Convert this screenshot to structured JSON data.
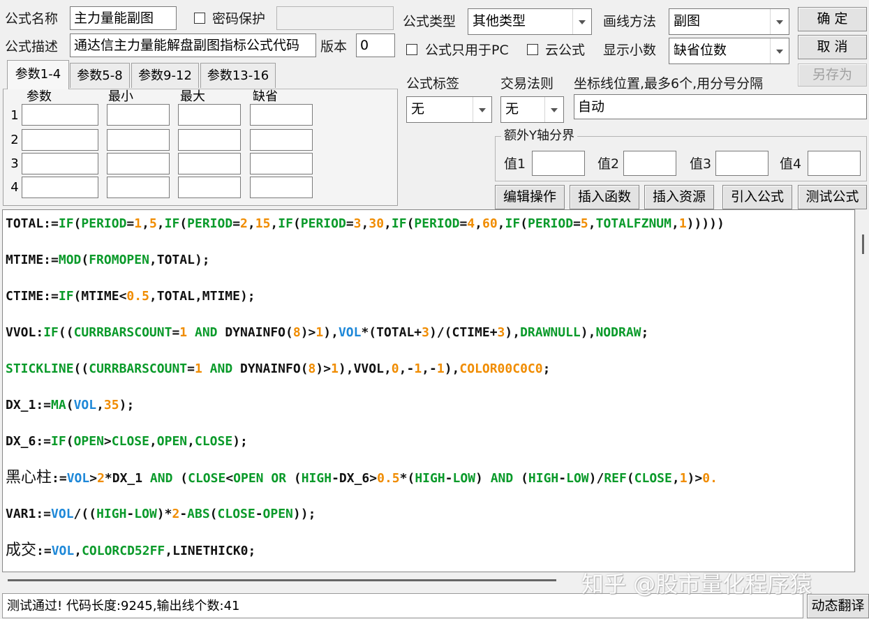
{
  "form": {
    "name_label": "公式名称",
    "name_value": "主力量能副图",
    "password_label": "密码保护",
    "desc_label": "公式描述",
    "desc_value": "通达信主力量能解盘副图指标公式代码",
    "version_label": "版本",
    "version_value": "0",
    "type_label": "公式类型",
    "type_value": "其他类型",
    "draw_label": "画线方法",
    "draw_value": "副图",
    "pc_only_label": "公式只用于PC",
    "cloud_label": "云公式",
    "decimals_label": "显示小数",
    "decimals_value": "缺省位数",
    "tag_label": "公式标签",
    "tag_value": "无",
    "rule_label": "交易法则",
    "rule_value": "无",
    "coord_label": "坐标线位置,最多6个,用分号分隔",
    "coord_value": "自动",
    "yaxis_group": "额外Y轴分界",
    "y1_label": "值1",
    "y2_label": "值2",
    "y3_label": "值3",
    "y4_label": "值4"
  },
  "buttons": {
    "ok": "确 定",
    "cancel": "取 消",
    "save_as": "另存为",
    "edit_ops": "编辑操作",
    "insert_func": "插入函数",
    "insert_res": "插入资源",
    "import": "引入公式",
    "test": "测试公式",
    "translate": "动态翻译"
  },
  "tabs": [
    "参数1-4",
    "参数5-8",
    "参数9-12",
    "参数13-16"
  ],
  "params": {
    "headers": [
      "参数",
      "最小",
      "最大",
      "缺省"
    ],
    "rows": [
      "1",
      "2",
      "3",
      "4"
    ]
  },
  "code_lines": [
    [
      [
        "TOTAL:=",
        "k"
      ],
      [
        "IF",
        "g"
      ],
      [
        "(",
        "k"
      ],
      [
        "PERIOD",
        "g"
      ],
      [
        "=",
        "k"
      ],
      [
        "1",
        "o"
      ],
      [
        ",",
        "k"
      ],
      [
        "5",
        "o"
      ],
      [
        ",",
        "k"
      ],
      [
        "IF",
        "g"
      ],
      [
        "(",
        "k"
      ],
      [
        "PERIOD",
        "g"
      ],
      [
        "=",
        "k"
      ],
      [
        "2",
        "o"
      ],
      [
        ",",
        "k"
      ],
      [
        "15",
        "o"
      ],
      [
        ",",
        "k"
      ],
      [
        "IF",
        "g"
      ],
      [
        "(",
        "k"
      ],
      [
        "PERIOD",
        "g"
      ],
      [
        "=",
        "k"
      ],
      [
        "3",
        "o"
      ],
      [
        ",",
        "k"
      ],
      [
        "30",
        "o"
      ],
      [
        ",",
        "k"
      ],
      [
        "IF",
        "g"
      ],
      [
        "(",
        "k"
      ],
      [
        "PERIOD",
        "g"
      ],
      [
        "=",
        "k"
      ],
      [
        "4",
        "o"
      ],
      [
        ",",
        "k"
      ],
      [
        "60",
        "o"
      ],
      [
        ",",
        "k"
      ],
      [
        "IF",
        "g"
      ],
      [
        "(",
        "k"
      ],
      [
        "PERIOD",
        "g"
      ],
      [
        "=",
        "k"
      ],
      [
        "5",
        "o"
      ],
      [
        ",",
        "k"
      ],
      [
        "TOTALFZNUM",
        "g"
      ],
      [
        ",",
        "k"
      ],
      [
        "1",
        "o"
      ],
      [
        ")))))",
        "k"
      ]
    ],
    [
      [
        "MTIME:=",
        "k"
      ],
      [
        "MOD",
        "g"
      ],
      [
        "(",
        "k"
      ],
      [
        "FROMOPEN",
        "g"
      ],
      [
        ",TOTAL);",
        "k"
      ]
    ],
    [
      [
        "CTIME:=",
        "k"
      ],
      [
        "IF",
        "g"
      ],
      [
        "(MTIME<",
        "k"
      ],
      [
        "0.5",
        "o"
      ],
      [
        ",TOTAL,MTIME);",
        "k"
      ]
    ],
    [
      [
        "VVOL:",
        "k"
      ],
      [
        "IF",
        "g"
      ],
      [
        "((",
        "k"
      ],
      [
        "CURRBARSCOUNT",
        "g"
      ],
      [
        "=",
        "k"
      ],
      [
        "1",
        "o"
      ],
      [
        " AND ",
        "g"
      ],
      [
        "DYNAINFO(",
        "k"
      ],
      [
        "8",
        "o"
      ],
      [
        ")>",
        "k"
      ],
      [
        "1",
        "o"
      ],
      [
        "),",
        "k"
      ],
      [
        "VOL",
        "b"
      ],
      [
        "*(TOTAL+",
        "k"
      ],
      [
        "3",
        "o"
      ],
      [
        ")/(CTIME+",
        "k"
      ],
      [
        "3",
        "o"
      ],
      [
        "),",
        "k"
      ],
      [
        "DRAWNULL",
        "g"
      ],
      [
        "),",
        "k"
      ],
      [
        "NODRAW",
        "g"
      ],
      [
        ";",
        "k"
      ]
    ],
    [
      [
        "STICKLINE",
        "g"
      ],
      [
        "((",
        "k"
      ],
      [
        "CURRBARSCOUNT",
        "g"
      ],
      [
        "=",
        "k"
      ],
      [
        "1",
        "o"
      ],
      [
        " AND ",
        "g"
      ],
      [
        "DYNAINFO(",
        "k"
      ],
      [
        "8",
        "o"
      ],
      [
        ")>",
        "k"
      ],
      [
        "1",
        "o"
      ],
      [
        "),VVOL,",
        "k"
      ],
      [
        "0",
        "o"
      ],
      [
        ",-",
        "k"
      ],
      [
        "1",
        "o"
      ],
      [
        ",-",
        "k"
      ],
      [
        "1",
        "o"
      ],
      [
        "),",
        "k"
      ],
      [
        "COLOR00C0C0",
        "o"
      ],
      [
        ";",
        "k"
      ]
    ],
    [
      [
        "DX_1:=",
        "k"
      ],
      [
        "MA",
        "g"
      ],
      [
        "(",
        "k"
      ],
      [
        "VOL",
        "b"
      ],
      [
        ",",
        "k"
      ],
      [
        "35",
        "o"
      ],
      [
        ");",
        "k"
      ]
    ],
    [
      [
        "DX_6:=",
        "k"
      ],
      [
        "IF",
        "g"
      ],
      [
        "(",
        "k"
      ],
      [
        "OPEN",
        "g"
      ],
      [
        ">",
        "k"
      ],
      [
        "CLOSE",
        "g"
      ],
      [
        ",",
        "k"
      ],
      [
        "OPEN",
        "g"
      ],
      [
        ",",
        "k"
      ],
      [
        "CLOSE",
        "g"
      ],
      [
        ");",
        "k"
      ]
    ],
    [
      [
        "黑心柱",
        "c"
      ],
      [
        ":=",
        "k"
      ],
      [
        "VOL",
        "b"
      ],
      [
        ">",
        "k"
      ],
      [
        "2",
        "o"
      ],
      [
        "*DX_1",
        "k"
      ],
      [
        " AND ",
        "g"
      ],
      [
        "(",
        "k"
      ],
      [
        "CLOSE",
        "g"
      ],
      [
        "<",
        "k"
      ],
      [
        "OPEN",
        "g"
      ],
      [
        " OR ",
        "g"
      ],
      [
        "(",
        "k"
      ],
      [
        "HIGH",
        "g"
      ],
      [
        "-DX_6>",
        "k"
      ],
      [
        "0.5",
        "o"
      ],
      [
        "*(",
        "k"
      ],
      [
        "HIGH",
        "g"
      ],
      [
        "-",
        "k"
      ],
      [
        "LOW",
        "g"
      ],
      [
        ")",
        "k"
      ],
      [
        " AND ",
        "g"
      ],
      [
        "(",
        "k"
      ],
      [
        "HIGH",
        "g"
      ],
      [
        "-",
        "k"
      ],
      [
        "LOW",
        "g"
      ],
      [
        ")/",
        "k"
      ],
      [
        "REF",
        "g"
      ],
      [
        "(",
        "k"
      ],
      [
        "CLOSE",
        "g"
      ],
      [
        ",",
        "k"
      ],
      [
        "1",
        "o"
      ],
      [
        ")>",
        "k"
      ],
      [
        "0.",
        "o"
      ]
    ],
    [
      [
        "VAR1:=",
        "k"
      ],
      [
        "VOL",
        "b"
      ],
      [
        "/((",
        "k"
      ],
      [
        "HIGH",
        "g"
      ],
      [
        "-",
        "k"
      ],
      [
        "LOW",
        "g"
      ],
      [
        ")*",
        "k"
      ],
      [
        "2",
        "o"
      ],
      [
        "-",
        "k"
      ],
      [
        "ABS",
        "g"
      ],
      [
        "(",
        "k"
      ],
      [
        "CLOSE",
        "g"
      ],
      [
        "-",
        "k"
      ],
      [
        "OPEN",
        "g"
      ],
      [
        "));",
        "k"
      ]
    ],
    [
      [
        "成交",
        "c"
      ],
      [
        ":=",
        "k"
      ],
      [
        "VOL",
        "b"
      ],
      [
        ",",
        "k"
      ],
      [
        "COLORCD52FF",
        "g"
      ],
      [
        ",LINETHICK0;",
        "k"
      ]
    ]
  ],
  "colors": {
    "k": "#111111",
    "g": "#0a9a2a",
    "o": "#f08c00",
    "b": "#1e88d8",
    "c": "#111111"
  },
  "status": "测试通过! 代码长度:9245,输出线个数:41",
  "watermark": "知乎 @股市量化程序猿"
}
